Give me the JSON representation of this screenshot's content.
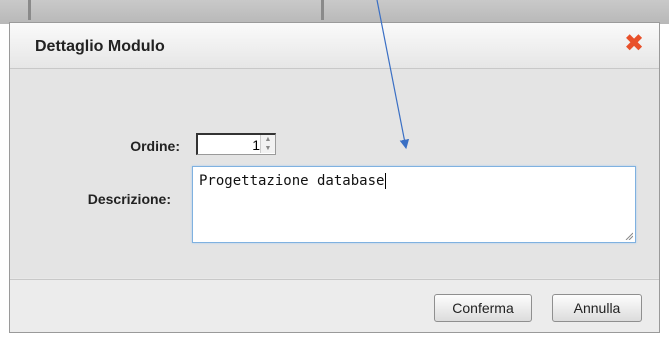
{
  "dialog": {
    "title": "Dettaglio Modulo",
    "close_icon": "close-icon",
    "fields": {
      "order_label": "Ordine:",
      "order_value": "1",
      "description_label": "Descrizione:",
      "description_value": "Progettazione database"
    },
    "buttons": {
      "confirm_label": "Conferma",
      "cancel_label": "Annulla"
    }
  },
  "annotation": {
    "arrow_color": "#3a6fc4"
  },
  "colors": {
    "close_icon": "#e8502a",
    "focus_border": "#7fb1e0"
  }
}
